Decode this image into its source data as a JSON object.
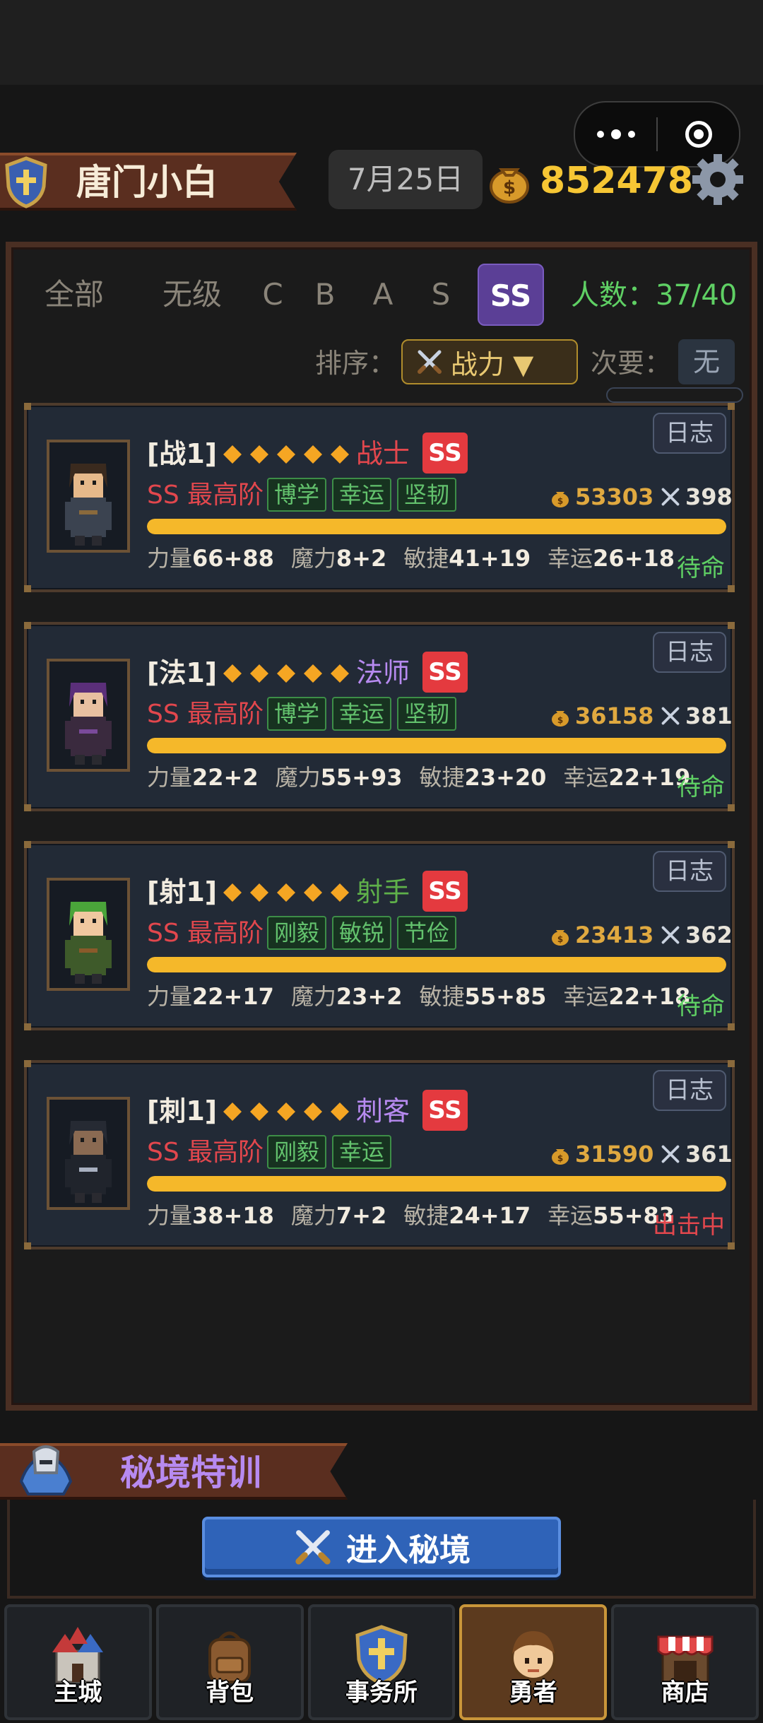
{
  "header": {
    "player_name": "唐门小白",
    "date": "7月25日",
    "gold": "852478"
  },
  "filters": {
    "tabs": [
      "全部",
      "无级",
      "C",
      "B",
      "A",
      "S",
      "SS"
    ],
    "active": "SS",
    "count_label": "人数：37/40"
  },
  "sort": {
    "label": "排序：",
    "value": "战力 ▼",
    "secondary_label": "次要：",
    "secondary_value": "无"
  },
  "heroes": [
    {
      "title": "[战1]",
      "stars": 5,
      "class": "战士",
      "class_color": "#e2474d",
      "grade": "SS",
      "rank": "SS 最高阶",
      "tags": [
        "博学",
        "幸运",
        "坚韧"
      ],
      "cost": "53303",
      "power": "398",
      "bar": 1.0,
      "stats": [
        [
          "力量",
          "66+88"
        ],
        [
          "魔力",
          "8+2"
        ],
        [
          "敏捷",
          "41+19"
        ],
        [
          "幸运",
          "26+18"
        ]
      ],
      "state": "待命",
      "state_color": "#5fd064",
      "log": "日志"
    },
    {
      "title": "[法1]",
      "stars": 5,
      "class": "法师",
      "class_color": "#b78af0",
      "grade": "SS",
      "rank": "SS 最高阶",
      "tags": [
        "博学",
        "幸运",
        "坚韧"
      ],
      "cost": "36158",
      "power": "381",
      "bar": 1.0,
      "stats": [
        [
          "力量",
          "22+2"
        ],
        [
          "魔力",
          "55+93"
        ],
        [
          "敏捷",
          "23+20"
        ],
        [
          "幸运",
          "22+19"
        ]
      ],
      "state": "待命",
      "state_color": "#5fd064",
      "log": "日志"
    },
    {
      "title": "[射1]",
      "stars": 5,
      "class": "射手",
      "class_color": "#5fb14a",
      "grade": "SS",
      "rank": "SS 最高阶",
      "tags": [
        "刚毅",
        "敏锐",
        "节俭"
      ],
      "cost": "23413",
      "power": "362",
      "bar": 1.0,
      "stats": [
        [
          "力量",
          "22+17"
        ],
        [
          "魔力",
          "23+2"
        ],
        [
          "敏捷",
          "55+85"
        ],
        [
          "幸运",
          "22+18"
        ]
      ],
      "state": "待命",
      "state_color": "#5fd064",
      "log": "日志"
    },
    {
      "title": "[刺1]",
      "stars": 5,
      "class": "刺客",
      "class_color": "#b78af0",
      "grade": "SS",
      "rank": "SS 最高阶",
      "tags": [
        "刚毅",
        "幸运"
      ],
      "cost": "31590",
      "power": "361",
      "bar": 1.0,
      "stats": [
        [
          "力量",
          "38+18"
        ],
        [
          "魔力",
          "7+2"
        ],
        [
          "敏捷",
          "24+17"
        ],
        [
          "幸运",
          "55+83"
        ]
      ],
      "state": "出击中",
      "state_color": "#e2474d",
      "log": "日志"
    }
  ],
  "realm": {
    "title": "秘境特训",
    "enter_label": "进入秘境"
  },
  "nav": [
    {
      "label": "主城",
      "icon": "castle-icon"
    },
    {
      "label": "背包",
      "icon": "backpack-icon"
    },
    {
      "label": "事务所",
      "icon": "shield-icon"
    },
    {
      "label": "勇者",
      "icon": "hero-face-icon",
      "active": true
    },
    {
      "label": "商店",
      "icon": "shop-icon"
    }
  ],
  "colors": {
    "accent_gold": "#f6c634",
    "active_tab": "#5b3f96",
    "grade_badge": "#e43a3f"
  }
}
